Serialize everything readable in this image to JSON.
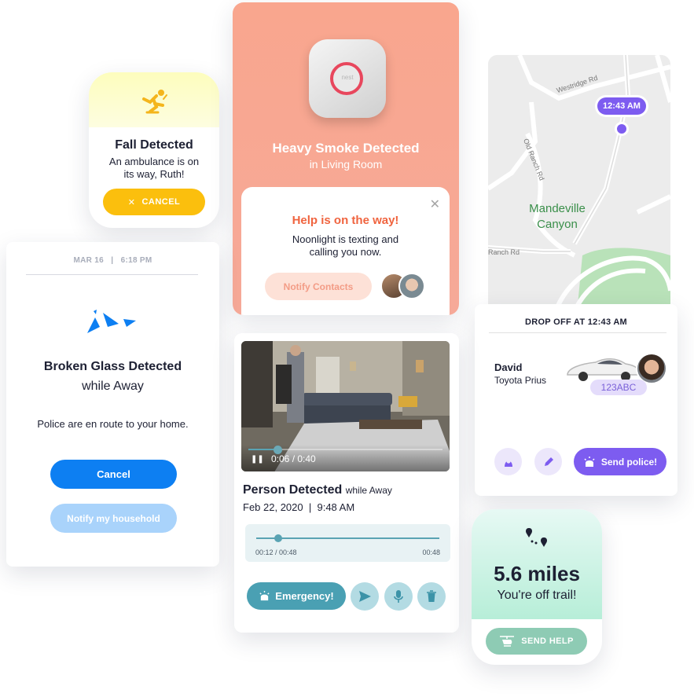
{
  "fall_card": {
    "title": "Fall Detected",
    "message": "An ambulance is on its way, Ruth!",
    "cancel_label": "CANCEL",
    "accent": "#fbbf0d",
    "icon": "falling-person-icon"
  },
  "smoke_card": {
    "device_logo": "nest",
    "title": "Heavy Smoke Detected",
    "location": "in Living Room",
    "background": "#f9a68e",
    "popup": {
      "heading": "Help is on the way!",
      "message": "Noonlight is texting and calling you now.",
      "notify_label": "Notify Contacts",
      "close_icon": "close-icon"
    }
  },
  "map_card": {
    "time_label": "12:43 AM",
    "place_name_line1": "Mandeville",
    "place_name_line2": "Canyon",
    "roads": [
      "Westridge Rd",
      "Old Ranch Rd",
      "Ranch Rd"
    ],
    "accent": "#7d5cf0"
  },
  "dropoff_card": {
    "heading": "DROP OFF AT 12:43 AM",
    "driver_name": "David",
    "car_model": "Toyota Prius",
    "plate": "123ABC",
    "send_police_label": "Send police!",
    "icons": [
      "driver-icon",
      "edit-icon",
      "siren-icon"
    ]
  },
  "glass_card": {
    "date": "MAR 16",
    "time": "6:18 PM",
    "title": "Broken Glass Detected",
    "subtitle": "while Away",
    "message": "Police are en route to your home.",
    "cancel_label": "Cancel",
    "household_label": "Notify my household",
    "accent": "#0d7ff2"
  },
  "person_card": {
    "video_time": "0:06 / 0:40",
    "video_progress": 0.15,
    "title": "Person Detected",
    "title_suffix": "while Away",
    "date": "Feb 22, 2020",
    "time": "9:48 AM",
    "audio_elapsed": "00:12 / 00:48",
    "audio_total": "00:48",
    "audio_progress": 0.12,
    "emergency_label": "Emergency!",
    "accent": "#4aa0b3",
    "icons": [
      "siren-icon",
      "send-icon",
      "microphone-icon",
      "trash-icon"
    ]
  },
  "trail_card": {
    "distance": "5.6 miles",
    "message": "You're off trail!",
    "send_help_label": "SEND HELP",
    "accent": "#8ecbb4",
    "icons": [
      "trail-pins-icon",
      "helicopter-icon"
    ]
  }
}
